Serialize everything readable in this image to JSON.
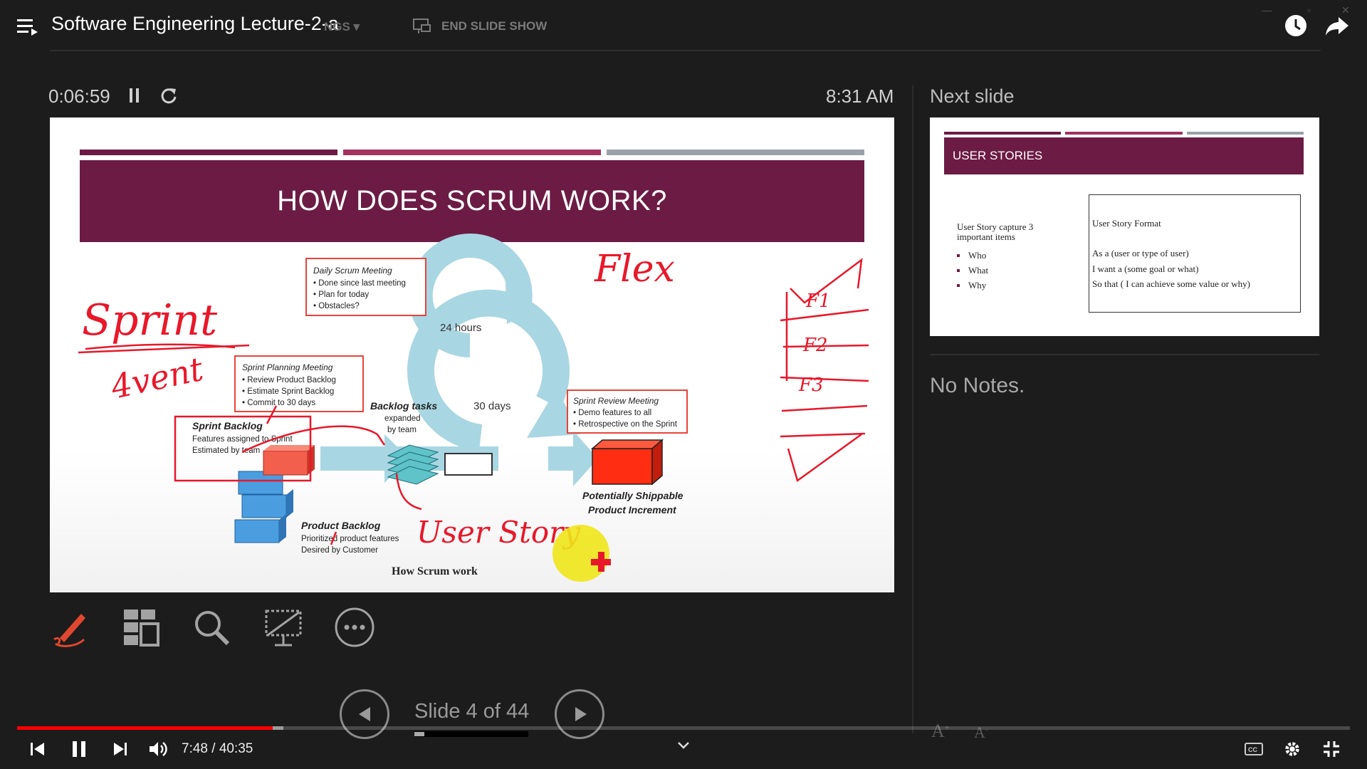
{
  "video": {
    "title": "Software Engineering Lecture-2-a",
    "time_current": "7:48",
    "time_separator": "/",
    "time_total": "40:35",
    "progress": 0.192,
    "buffered": 0.2
  },
  "toolbar": {
    "settings_fragment": "NGS ▾",
    "end_slide_show": "END SLIDE SHOW"
  },
  "presenter": {
    "elapsed": "0:06:59",
    "clock": "8:31 AM",
    "next_slide_label": "Next slide",
    "notes_text": "No Notes.",
    "slide_counter": "Slide 4 of 44",
    "slide_progress": 0.09
  },
  "current_slide": {
    "title": "HOW DOES SCRUM WORK?",
    "daily_title": "Daily Scrum Meeting",
    "daily_items": [
      "• Done since last meeting",
      "• Plan for today",
      "• Obstacles?"
    ],
    "planning_title": "Sprint Planning Meeting",
    "planning_items": [
      "• Review Product Backlog",
      "• Estimate Sprint Backlog",
      "• Commit to 30 days"
    ],
    "review_title": "Sprint Review Meeting",
    "review_items": [
      "• Demo features to all",
      "• Retrospective on the Sprint"
    ],
    "hours": "24 hours",
    "days": "30 days",
    "backlog_tasks": "Backlog tasks",
    "backlog_tasks_sub1": "expanded",
    "backlog_tasks_sub2": "by team",
    "sprint_backlog": "Sprint Backlog",
    "sprint_backlog_sub1": "Features assigned to Sprint",
    "sprint_backlog_sub2": "Estimated by team",
    "product_backlog": "Product Backlog",
    "product_backlog_sub1": "Prioritized product features",
    "product_backlog_sub2": "Desired by Customer",
    "shippable1": "Potentially Shippable",
    "shippable2": "Product Increment",
    "caption": "How Scrum work",
    "hw_flex": "Flex",
    "hw_sprint": "Sprint",
    "hw_event": "4vent",
    "hw_user_story": "User Story",
    "hw_f1": "F1",
    "hw_f2": "F2",
    "hw_f3": "F3"
  },
  "next_slide": {
    "title": "USER STORIES",
    "left_text": "User Story capture 3 important items",
    "bullets": [
      "Who",
      "What",
      "Why"
    ],
    "format_title": "User Story Format",
    "format_lines": [
      "As a (user or type of user)",
      "I want a (some goal or what)",
      "So that ( I can achieve some value or why)"
    ]
  },
  "colors": {
    "accent_red": "#ff0000",
    "banner": "#6c1b44",
    "bar_pink": "#a3325f",
    "bar_grey": "#9aa1a8",
    "ink": "#e8182a",
    "pen_orange": "#e0472f"
  },
  "icons": [
    "menu-icon",
    "watch-later-icon",
    "share-icon",
    "pause-icon",
    "reset-icon",
    "pen-icon",
    "slides-grid-icon",
    "zoom-icon",
    "screen-icon",
    "more-icon",
    "prev-icon",
    "next-icon",
    "skip-back-icon",
    "play-pause-icon",
    "skip-forward-icon",
    "volume-icon",
    "chevron-down-icon",
    "captions-icon",
    "settings-icon",
    "exit-fullscreen-icon",
    "font-increase-icon",
    "font-decrease-icon"
  ]
}
